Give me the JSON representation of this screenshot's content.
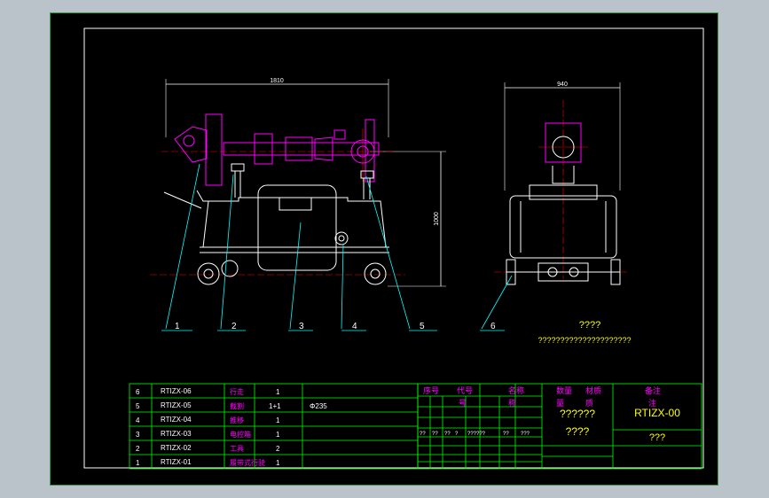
{
  "drawing": {
    "dim_width_side": "1810",
    "dim_width_front": "940",
    "dim_height": "1000",
    "note_title": "????",
    "note_text": "?????????????????????",
    "callouts": [
      "1",
      "2",
      "3",
      "4",
      "5",
      "6"
    ],
    "panel_labels": [
      "",
      "",
      "",
      "",
      "",
      ""
    ]
  },
  "parts_list": {
    "rows": [
      {
        "no": "6",
        "code": "RTIZX-06",
        "name": "行走",
        "qty": "1",
        "remark": ""
      },
      {
        "no": "5",
        "code": "RTIZX-05",
        "name": "截割",
        "qty": "1+1",
        "remark": "Φ235"
      },
      {
        "no": "4",
        "code": "RTIZX-04",
        "name": "推移",
        "qty": "1",
        "remark": ""
      },
      {
        "no": "3",
        "code": "RTIZX-03",
        "name": "电控箱",
        "qty": "1",
        "remark": ""
      },
      {
        "no": "2",
        "code": "RTIZX-02",
        "name": "工具",
        "qty": "2",
        "remark": ""
      },
      {
        "no": "1",
        "code": "RTIZX-01",
        "name": "履带式行驶",
        "qty": "1",
        "remark": ""
      }
    ],
    "header": {
      "no": "序号",
      "code": "代号",
      "name": "名称",
      "qty": "数量",
      "material": "材质",
      "remark": "备注"
    },
    "header_sub": {
      "code2": "号",
      "name2": "称",
      "qty2": "量",
      "mat2": "质",
      "rem2": "注"
    }
  },
  "title_block": {
    "drawing_no": "RTIZX-00",
    "title_q": "????",
    "title_q2": "??????",
    "scale_q": "???",
    "mini_q": [
      "??",
      "??",
      "??",
      "?",
      "??????",
      "??",
      "???"
    ]
  },
  "colors": {
    "green": "#00ff00",
    "magenta": "#ff00ff",
    "cyan": "#00ffff",
    "white": "#ffffff",
    "red": "#ff0000",
    "yellow": "#ffff00"
  }
}
